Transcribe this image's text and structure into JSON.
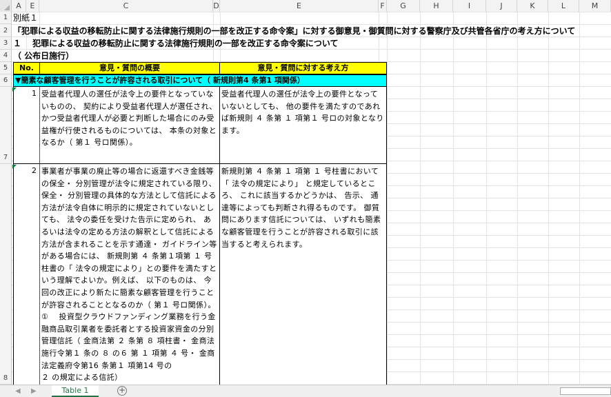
{
  "columns": [
    "A",
    "E",
    "C",
    "D",
    "E",
    "F",
    "G",
    "H",
    "I",
    "J",
    "K",
    "L",
    "M"
  ],
  "rows": [
    "1",
    "2",
    "3",
    "4",
    "5",
    "6",
    "7",
    "8"
  ],
  "sheet": {
    "r1": "別紙１",
    "r2": "「犯罪による収益の移転防止に関する法律施行規則の一部を改正する命令案」に対する御意見・御質問に対する警察庁及び共管各省庁の考え方について",
    "r3": "１　 犯罪による収益の移転防止に関する法律施行規則の一部を改正する命令案について",
    "r4": "（ 公布日施行）"
  },
  "table": {
    "header_no": "No.",
    "header_summary": "意見・質問の概要",
    "header_answer": "意見・質問に対する考え方",
    "category": "▼簡素な顧客管理を行うことが許容される取引について（ 新規則第4 条第1 項関係）",
    "rows": [
      {
        "no": "1",
        "summary": "受益者代理人の選任が法令上の要件となっていないものの、 契約により受益者代理人が選任され、 かつ受益者代理人が必要と判断した場合にのみ受益権が行使されるものについては、 本条の対象となるか（ 第１ 号ロ関係）。",
        "answer": "受益者代理人の選任が法令上の要件となっていないとしても、 他の要件を満たすのであれば新規則 ４ 条第 １ 項第１ 号ロの対象となります。"
      },
      {
        "no": "2",
        "summary": "事業者が事業の廃止等の場合に返還すべき金銭等の保全・ 分別管理が法令に規定されている限り、 保全・ 分別管理の具体的な方法として信託による方法が法令自体に明示的に規定されていないとしても、 法令の委任を受けた告示に定められ、 あるいは法令の定める方法の解釈として信託による方法が含まれることを示す通達・ ガイドライン等がある場合には、 新規則第 ４ 条第１項第 １ 号柱書の「 法令の規定により」との要件を満たすという理解でよいか。例えば、 以下のものは、 今回の改正により新たに簡素な顧客管理を行うことが許容されることとなるのか（ 第１ 号ロ関係）。\n①　 投資型クラウドファンディング業務を行う金融商品取引業者を委託者とする投資家資金の分別管理信託（ 金商法第 ２ 条第 ８ 項柱書・ 金商法施行令第１ 条の ８ の６ 第 １ 項第 ４ 号・ 金商法定義府令第16 条第１ 項第14 号の\n２ の規定による信託）",
        "answer": "新規則第 ４ 条第 １ 項第 １ 号柱書において「 法令の規定により」 と規定しているところ、 これに該当するかどうかは、 告示、 通達等によっても判断され得るものです。 御質問にあります信託については、 いずれも簡素な顧客管理を行うことが許容される取引に該当すると考えられます。"
      }
    ]
  },
  "tabs": {
    "sheet_name": "Table 1",
    "add_label": "+",
    "prev_label": "◀",
    "next_label": "▶"
  }
}
